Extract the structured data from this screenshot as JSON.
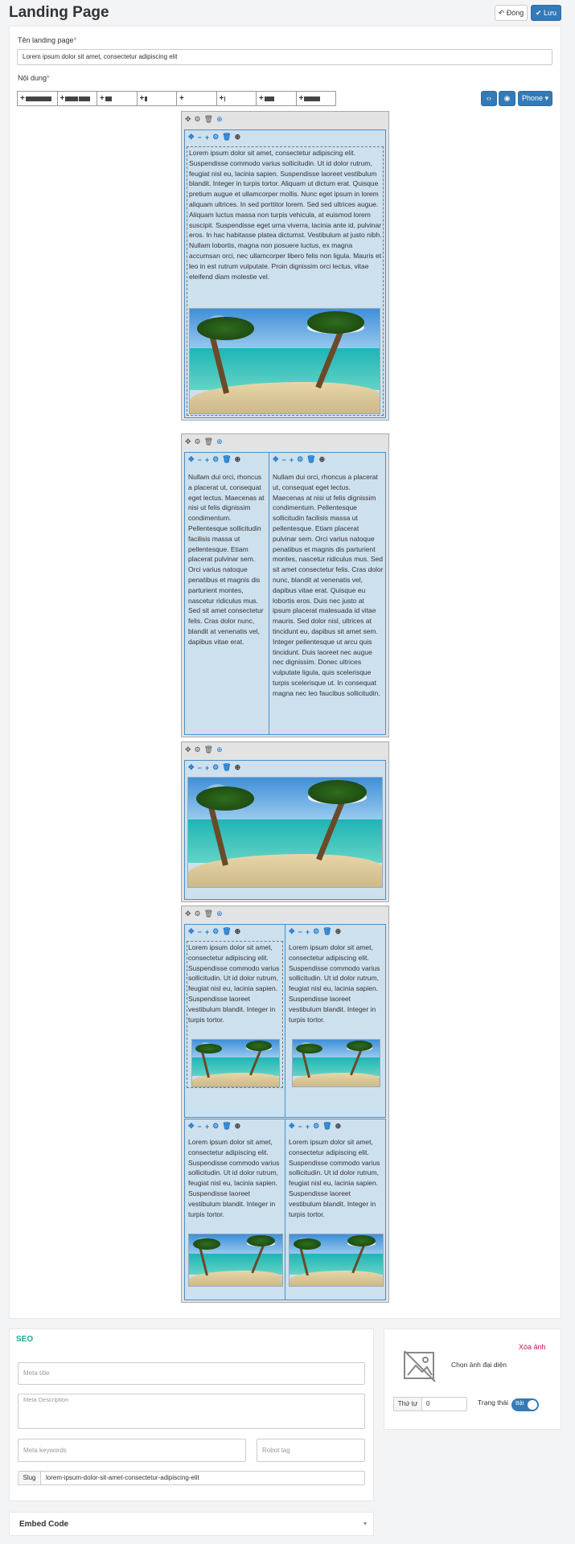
{
  "header": {
    "title": "Landing Page",
    "close_label": "Đóng",
    "save_label": "Lưu"
  },
  "form": {
    "name_label": "Tên landing page",
    "name_value": "Lorem ipsum dolor sit amet, consectetur adipiscing elit",
    "content_label": "Nội dung",
    "required_mark": "*",
    "device_label": "Phone"
  },
  "blocks": {
    "block1_text": "Lorem ipsum dolor sit amet, consectetur adipiscing elit. Suspendisse commodo varius sollicitudin. Ut id dolor rutrum, feugiat nisl eu, lacinia sapien. Suspendisse laoreet vestibulum blandit. Integer in turpis tortor. Aliquam ut dictum erat. Quisque pretium augue et ullamcorper mollis. Nunc eget ipsum in lorem aliquam ultrices. In sed porttitor lorem. Sed sed ultrices augue. Aliquam luctus massa non turpis vehicula, at euismod lorem suscipit. Suspendisse eget urna viverra, lacinia ante id, pulvinar eros. In hac habitasse platea dictumst. Vestibulum at justo nibh. Nullam lobortis, magna non posuere luctus, ex magna accumsan orci, nec ullamcorper libero felis non ligula. Mauris et leo in est rutrum vulputate. Proin dignissim orci lectus, vitae eleifend diam molestie vel.",
    "block2_left": "Nullam dui orci, rhoncus a placerat ut, consequat eget lectus. Maecenas at nisi ut felis dignissim condimentum. Pellentesque sollicitudin facilisis massa ut pellentesque. Etiam placerat pulvinar sem. Orci varius natoque penatibus et magnis dis parturient montes, nascetur ridiculus mus. Sed sit amet consectetur felis. Cras dolor nunc, blandit at venenatis vel, dapibus vitae erat.",
    "block2_right": "Nullam dui orci, rhoncus a placerat ut, consequat eget lectus. Maecenas at nisi ut felis dignissim condimentum. Pellentesque sollicitudin facilisis massa ut pellentesque. Etiam placerat pulvinar sem. Orci varius natoque penatibus et magnis dis parturient montes, nascetur ridiculus mus. Sed sit amet consectetur felis. Cras dolor nunc, blandit at venenatis vel, dapibus vitae erat. Quisque eu lobortis eros. Duis nec justo at ipsum placerat malesuada id vitae mauris. Sed dolor nisl, ultrices at tincidunt eu, dapibus sit amet sem. Integer pellentesque ut arcu quis tincidunt. Duis laoreet nec augue nec dignissim. Donec ultrices vulputate ligula, quis scelerisque turpis scelerisque ut. In consequat magna nec leo faucibus sollicitudin.",
    "grid_text": "Lorem ipsum dolor sit amet, consectetur adipiscing elit. Suspendisse commodo varius sollicitudin. Ut id dolor rutrum, feugiat nisl eu, lacinia sapien. Suspendisse laoreet vestibulum blandit. Integer in turpis tortor."
  },
  "seo": {
    "title": "SEO",
    "meta_title_placeholder": "Meta title",
    "meta_description_placeholder": "Meta Description",
    "meta_keywords_placeholder": "Meta keywords",
    "robot_tag_placeholder": "Robot tag",
    "slug_label": "Slug",
    "slug_value": "lorem-ipsum-dolor-sit-amet-consectetur-adipiscing-elit"
  },
  "side": {
    "remove_image": "Xóa ảnh",
    "choose_image": "Chọn ảnh đại diện",
    "order_label": "Thứ tự",
    "order_value": "0",
    "status_label": "Trạng thái",
    "toggle_text": "Bật"
  },
  "embed": {
    "title": "Embed Code"
  },
  "colors": {
    "primary": "#337ab7",
    "accent": "#26a69a",
    "danger": "#d9534f",
    "column_bg": "#cde0ee"
  }
}
